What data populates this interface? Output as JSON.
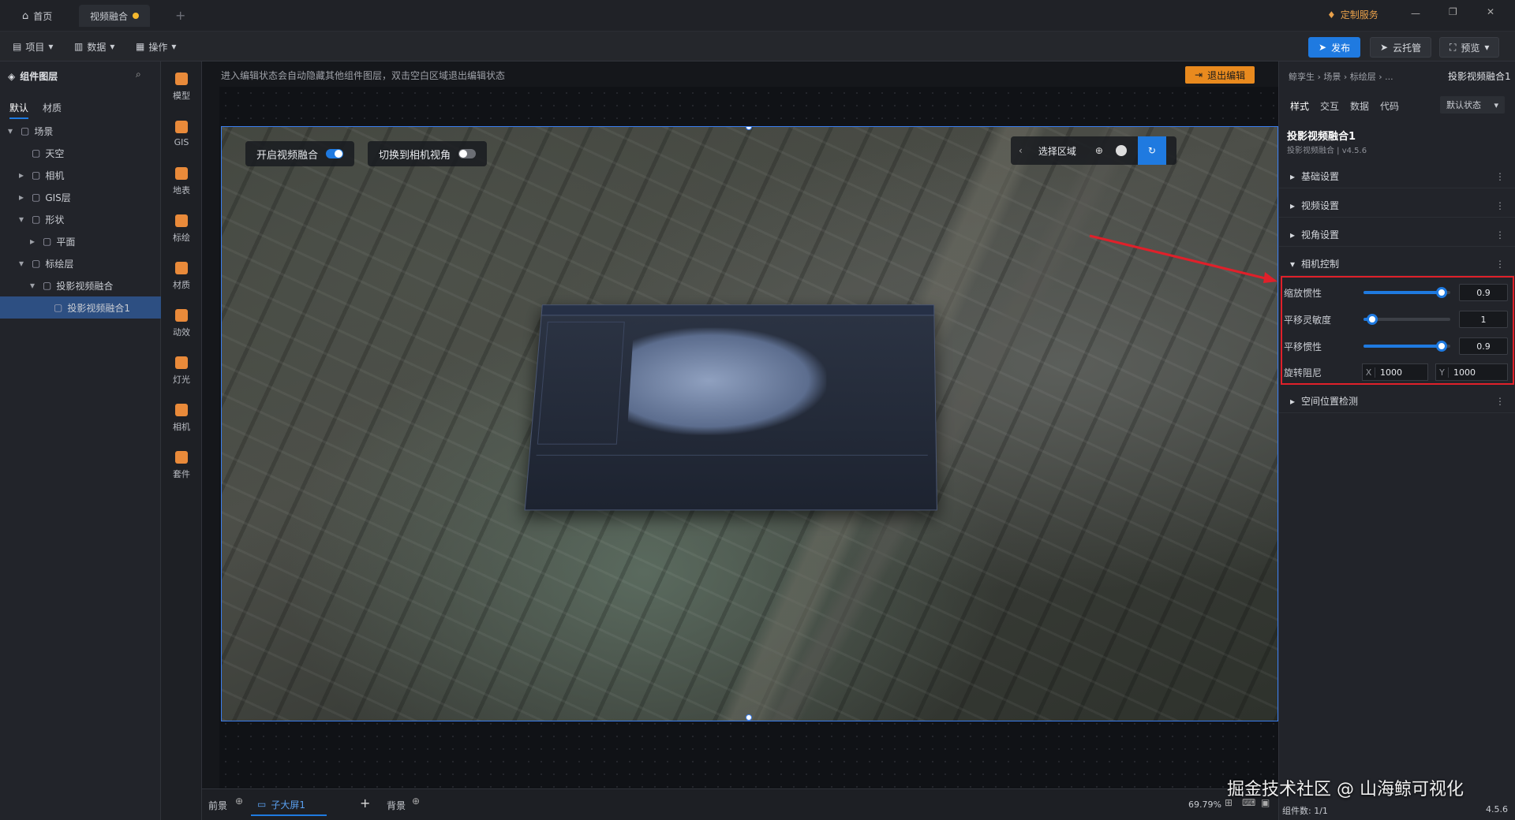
{
  "titlebar": {
    "home_tab": "首页",
    "doc_tab": "视频融合",
    "custom_service": "定制服务"
  },
  "toolbar": {
    "project": "项目",
    "data": "数据",
    "ops": "操作",
    "publish": "发布",
    "cloud": "云托管",
    "preview": "预览"
  },
  "layers": {
    "title": "组件图层",
    "tabs": [
      "默认",
      "材质"
    ],
    "items": [
      {
        "label": "场景",
        "indent": 0,
        "arrow": "▾",
        "sel": false
      },
      {
        "label": "天空",
        "indent": 1,
        "arrow": "",
        "sel": false
      },
      {
        "label": "相机",
        "indent": 1,
        "arrow": "▸",
        "sel": false
      },
      {
        "label": "GIS层",
        "indent": 1,
        "arrow": "▸",
        "sel": false
      },
      {
        "label": "形状",
        "indent": 1,
        "arrow": "▾",
        "sel": false
      },
      {
        "label": "平面",
        "indent": 2,
        "arrow": "▸",
        "sel": false
      },
      {
        "label": "标绘层",
        "indent": 1,
        "arrow": "▾",
        "sel": false
      },
      {
        "label": "投影视频融合",
        "indent": 2,
        "arrow": "▾",
        "sel": false
      },
      {
        "label": "投影视频融合1",
        "indent": 3,
        "arrow": "",
        "sel": true
      }
    ]
  },
  "iconbar": [
    "模型",
    "GIS",
    "地表",
    "标绘",
    "材质",
    "动效",
    "灯光",
    "相机",
    "套件"
  ],
  "canvas": {
    "hint": "进入编辑状态会自动隐藏其他组件图层，双击空白区域退出编辑状态",
    "exit_edit": "退出编辑",
    "toggle_fusion": "开启视频融合",
    "toggle_camera": "切换到相机视角",
    "select_area": "选择区域"
  },
  "right": {
    "breadcrumb": "鲸孪生 › 场景 › 标绘层 › ...",
    "selected": "投影视频融合1",
    "tabs": [
      "样式",
      "交互",
      "数据",
      "代码"
    ],
    "state_select": "默认状态",
    "comp_name": "投影视频融合1",
    "comp_sub": "投影视频融合 | v4.5.6",
    "sections": [
      "基础设置",
      "视频设置",
      "视角设置",
      "相机控制",
      "空间位置检测"
    ],
    "zoom_inertia": {
      "label": "缩放惯性",
      "value": "0.9",
      "fraction": 0.9
    },
    "pan_sensitivity": {
      "label": "平移灵敏度",
      "value": "1",
      "fraction": 0.1
    },
    "pan_inertia": {
      "label": "平移惯性",
      "value": "0.9",
      "fraction": 0.9
    },
    "rotate_damping": {
      "label": "旋转阻尼",
      "x_label": "X",
      "x": "1000",
      "y_label": "Y",
      "y": "1000"
    }
  },
  "bottom": {
    "front": "前景",
    "screen": "子大屏1",
    "back": "背景",
    "zoom": "69.79%",
    "components": "组件数: 1/1",
    "version": "4.5.6"
  },
  "watermark": "掘金技术社区 @ 山海鲸可视化",
  "colors": {
    "accent": "#1f7ae0",
    "highlight": "#e0202a",
    "exit_btn": "#e98a1e"
  }
}
